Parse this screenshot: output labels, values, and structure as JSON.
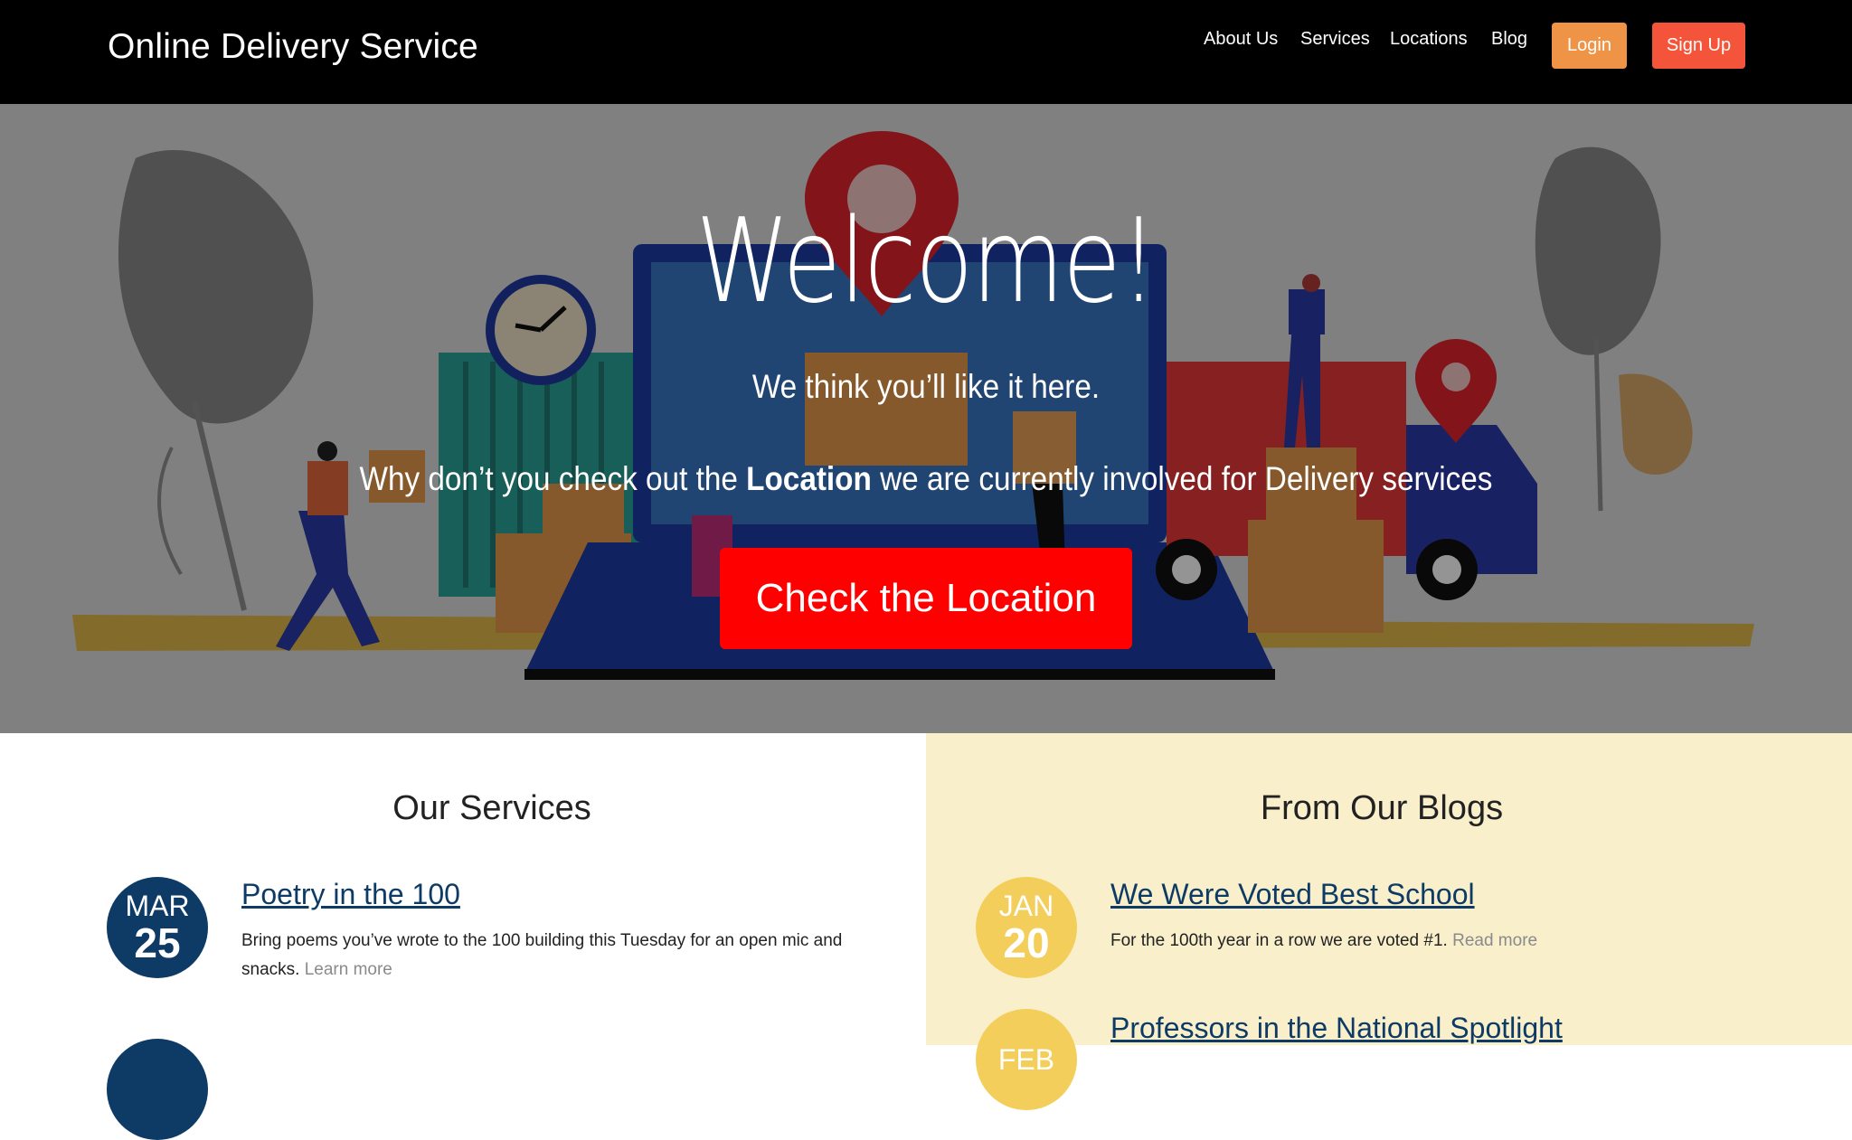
{
  "header": {
    "brand": "Online Delivery Service",
    "nav": [
      "About Us",
      "Services",
      "Locations",
      "Blog"
    ],
    "login_label": "Login",
    "signup_label": "Sign Up",
    "colors": {
      "login": "#ef9446",
      "signup": "#f4553a",
      "bar": "#000000"
    }
  },
  "hero": {
    "title": "Welcome!",
    "subtitle": "We think you’ll like it here.",
    "line_before": "Why don’t you check out the ",
    "line_bold": "Location",
    "line_after": " we are currently involved for Delivery services",
    "cta_label": "Check the Location",
    "colors": {
      "cta": "#fe0000"
    }
  },
  "services": {
    "title": "Our Services",
    "items": [
      {
        "month": "MAR",
        "day": "25",
        "title": "Poetry in the 100",
        "text": "Bring poems you’ve wrote to the 100 building this Tuesday for an open mic and snacks.",
        "more": "Learn more"
      }
    ]
  },
  "blogs": {
    "title": "From Our Blogs",
    "items": [
      {
        "month": "JAN",
        "day": "20",
        "title": "We Were Voted Best School",
        "text": "For the 100th year in a row we are voted #1.",
        "more": "Read more"
      },
      {
        "month": "FEB",
        "title": "Professors in the National Spotlight"
      }
    ]
  }
}
